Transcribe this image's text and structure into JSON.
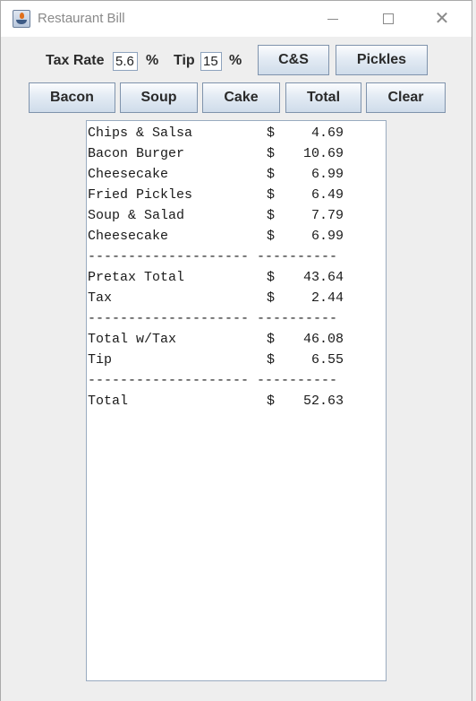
{
  "window": {
    "title": "Restaurant Bill",
    "controls": {
      "minimize": "minimize",
      "maximize": "maximize",
      "close": "close"
    }
  },
  "inputs": {
    "tax_rate_label": "Tax Rate",
    "tax_rate_value": "5.6",
    "tax_percent": "%",
    "tip_label": "Tip",
    "tip_value": "15",
    "tip_percent": "%"
  },
  "buttons": {
    "cs": "C&S",
    "pickles": "Pickles",
    "bacon": "Bacon",
    "soup": "Soup",
    "cake": "Cake",
    "total": "Total",
    "clear": "Clear"
  },
  "receipt": {
    "items": [
      {
        "name": "Chips & Salsa",
        "currency": "$",
        "amount": "4.69"
      },
      {
        "name": "Bacon Burger",
        "currency": "$",
        "amount": "10.69"
      },
      {
        "name": "Cheesecake",
        "currency": "$",
        "amount": "6.99"
      },
      {
        "name": "Fried Pickles",
        "currency": "$",
        "amount": "6.49"
      },
      {
        "name": "Soup & Salad",
        "currency": "$",
        "amount": "7.79"
      },
      {
        "name": "Cheesecake",
        "currency": "$",
        "amount": "6.99"
      }
    ],
    "separator": "-------------------- ----------",
    "pretax": {
      "name": "Pretax Total",
      "currency": "$",
      "amount": "43.64"
    },
    "tax": {
      "name": "Tax",
      "currency": "$",
      "amount": "2.44"
    },
    "total_with_tax": {
      "name": "Total w/Tax",
      "currency": "$",
      "amount": "46.08"
    },
    "tip": {
      "name": "Tip",
      "currency": "$",
      "amount": "6.55"
    },
    "grand_total": {
      "name": "Total",
      "currency": "$",
      "amount": "52.63"
    }
  }
}
